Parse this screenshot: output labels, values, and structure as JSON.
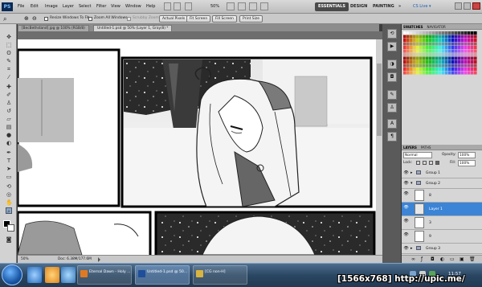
{
  "app": {
    "logo": "PS",
    "menu": [
      "File",
      "Edit",
      "Image",
      "Layer",
      "Select",
      "Filter",
      "View",
      "Window",
      "Help"
    ],
    "zoom": "50%",
    "workspaces": [
      "ESSENTIALS",
      "DESIGN",
      "PAINTING"
    ],
    "workspace_more": "»",
    "cs_live": "CS Live ▾"
  },
  "options": {
    "resize": "Resize Windows To Fit",
    "zoom_all": "Zoom All Windows",
    "scrubby": "Scrubby Zoom",
    "buttons": [
      "Actual Pixels",
      "Fit Screen",
      "Fill Screen",
      "Print Size"
    ]
  },
  "tabs": [
    "[BecBethstand].jpg @ 100% (RGB/8)",
    "Untitled-1.psd @ 50% (Layer 1, Gray/8) *"
  ],
  "status": {
    "zoom": "50%",
    "doc": "Doc: 6.38M/177.6M"
  },
  "panels": {
    "swatches_tabs": [
      "SWATCHES",
      "NAVIGATOR"
    ],
    "layers_tabs": [
      "LAYERS",
      "PATHS"
    ],
    "blend": "Normal",
    "opacity_label": "Opacity:",
    "opacity": "100%",
    "lock_label": "Lock:",
    "fill_label": "Fill:",
    "fill": "100%",
    "layers": [
      {
        "name": "Group 1",
        "type": "group"
      },
      {
        "name": "Group 2",
        "type": "group"
      },
      {
        "name": "8",
        "type": "layer"
      },
      {
        "name": "Layer 1",
        "type": "layer",
        "selected": true
      },
      {
        "name": "3",
        "type": "layer"
      },
      {
        "name": "9",
        "type": "layer"
      },
      {
        "name": "Group 3",
        "type": "group"
      },
      {
        "name": "Group 4",
        "type": "group"
      }
    ]
  },
  "taskbar": {
    "buttons": [
      {
        "label": "Eternal Dawn - Holy ...",
        "color": "#e07a22"
      },
      {
        "label": "Untitled-1.psd @ 50...",
        "color": "#1f4f9a"
      },
      {
        "label": "[CG non-H]",
        "color": "#d8b440"
      }
    ],
    "clock": "11:57"
  },
  "watermark": "[1566x768] http://upic.me/",
  "colors": {
    "accent": "#3b84d6",
    "taskbar": "#2a4662",
    "canvas_bg": "#6e6e6e"
  }
}
